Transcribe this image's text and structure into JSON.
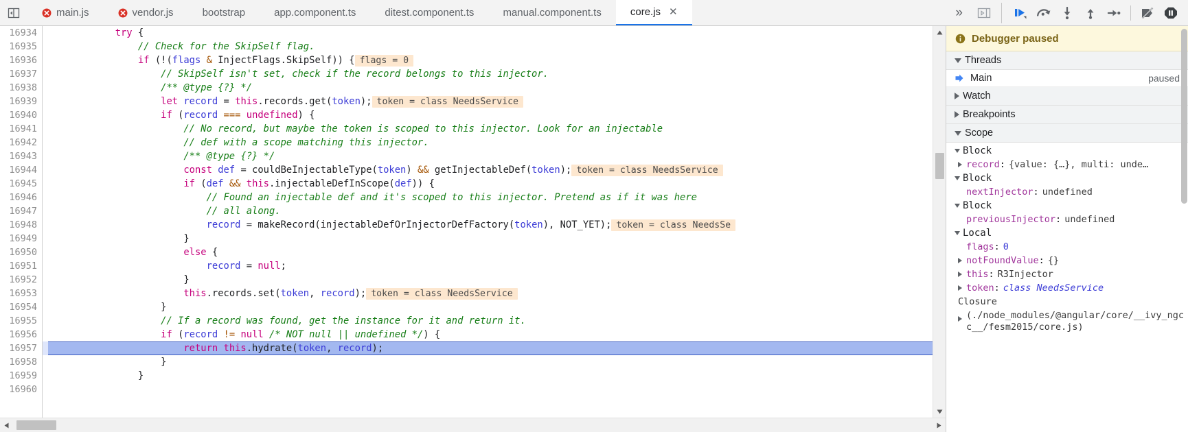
{
  "window": {
    "panel_toggle_icon": "dock-to-left-icon"
  },
  "tabbar": {
    "tabs": [
      {
        "label": "main.js",
        "error": true,
        "active": false
      },
      {
        "label": "vendor.js",
        "error": true,
        "active": false
      },
      {
        "label": "bootstrap",
        "error": false,
        "active": false
      },
      {
        "label": "app.component.ts",
        "error": false,
        "active": false
      },
      {
        "label": "ditest.component.ts",
        "error": false,
        "active": false
      },
      {
        "label": "manual.component.ts",
        "error": false,
        "active": false
      },
      {
        "label": "core.js",
        "error": false,
        "active": true,
        "close": "✕"
      }
    ],
    "more_label": "»"
  },
  "debug_toolbar": {
    "buttons": [
      {
        "name": "show-navigator-button",
        "icon": "panel-layout-icon",
        "tooltip": "Show navigator"
      },
      {
        "name": "resume-button",
        "icon": "resume-script-execution-icon",
        "tooltip": "Resume script execution"
      },
      {
        "name": "step-over-button",
        "icon": "step-over-next-function-call-icon",
        "tooltip": "Step over next function call"
      },
      {
        "name": "step-into-button",
        "icon": "step-into-next-function-call-icon",
        "tooltip": "Step into next function call"
      },
      {
        "name": "step-out-button",
        "icon": "step-out-of-current-function-icon",
        "tooltip": "Step out of current function"
      },
      {
        "name": "step-button",
        "icon": "step-icon",
        "tooltip": "Step"
      },
      {
        "name": "deactivate-breakpoints-button",
        "icon": "deactivate-breakpoints-icon",
        "tooltip": "Deactivate breakpoints"
      },
      {
        "name": "pause-on-exceptions-button",
        "icon": "pause-on-exceptions-icon",
        "tooltip": "Pause on exceptions"
      }
    ]
  },
  "editor": {
    "first_line": 16934,
    "lines": [
      {
        "n": 16934,
        "exec": false,
        "tokens": [
          {
            "t": "            ",
            "c": "pln"
          },
          {
            "t": "try",
            "c": "kw"
          },
          {
            "t": " {",
            "c": "pln"
          }
        ]
      },
      {
        "n": 16935,
        "exec": false,
        "tokens": [
          {
            "t": "                ",
            "c": "pln"
          },
          {
            "t": "// Check for the SkipSelf flag.",
            "c": "cmt"
          }
        ]
      },
      {
        "n": 16936,
        "exec": false,
        "tokens": [
          {
            "t": "                ",
            "c": "pln"
          },
          {
            "t": "if",
            "c": "kw"
          },
          {
            "t": " (!(",
            "c": "pln"
          },
          {
            "t": "flags",
            "c": "var"
          },
          {
            "t": " & ",
            "c": "op"
          },
          {
            "t": "InjectFlags.SkipSelf)) {",
            "c": "pln"
          },
          {
            "t": "flags = 0",
            "c": "chip"
          }
        ]
      },
      {
        "n": 16937,
        "exec": false,
        "tokens": [
          {
            "t": "                    ",
            "c": "pln"
          },
          {
            "t": "// SkipSelf isn't set, check if the record belongs to this injector.",
            "c": "cmt"
          }
        ]
      },
      {
        "n": 16938,
        "exec": false,
        "tokens": [
          {
            "t": "                    ",
            "c": "pln"
          },
          {
            "t": "/** @type {?} */",
            "c": "cmt"
          }
        ]
      },
      {
        "n": 16939,
        "exec": false,
        "tokens": [
          {
            "t": "                    ",
            "c": "pln"
          },
          {
            "t": "let",
            "c": "kw"
          },
          {
            "t": " ",
            "c": "pln"
          },
          {
            "t": "record",
            "c": "var"
          },
          {
            "t": " = ",
            "c": "pln"
          },
          {
            "t": "this",
            "c": "kw"
          },
          {
            "t": ".records.get(",
            "c": "pln"
          },
          {
            "t": "token",
            "c": "var"
          },
          {
            "t": ");",
            "c": "pln"
          },
          {
            "t": "token = class NeedsService",
            "c": "chip"
          }
        ]
      },
      {
        "n": 16940,
        "exec": false,
        "tokens": [
          {
            "t": "                    ",
            "c": "pln"
          },
          {
            "t": "if",
            "c": "kw"
          },
          {
            "t": " (",
            "c": "pln"
          },
          {
            "t": "record",
            "c": "var"
          },
          {
            "t": " === ",
            "c": "op"
          },
          {
            "t": "undefined",
            "c": "kw"
          },
          {
            "t": ") {",
            "c": "pln"
          }
        ]
      },
      {
        "n": 16941,
        "exec": false,
        "tokens": [
          {
            "t": "                        ",
            "c": "pln"
          },
          {
            "t": "// No record, but maybe the token is scoped to this injector. Look for an injectable",
            "c": "cmt"
          }
        ]
      },
      {
        "n": 16942,
        "exec": false,
        "tokens": [
          {
            "t": "                        ",
            "c": "pln"
          },
          {
            "t": "// def with a scope matching this injector.",
            "c": "cmt"
          }
        ]
      },
      {
        "n": 16943,
        "exec": false,
        "tokens": [
          {
            "t": "                        ",
            "c": "pln"
          },
          {
            "t": "/** @type {?} */",
            "c": "cmt"
          }
        ]
      },
      {
        "n": 16944,
        "exec": false,
        "tokens": [
          {
            "t": "                        ",
            "c": "pln"
          },
          {
            "t": "const",
            "c": "kw"
          },
          {
            "t": " ",
            "c": "pln"
          },
          {
            "t": "def",
            "c": "var"
          },
          {
            "t": " = couldBeInjectableType(",
            "c": "pln"
          },
          {
            "t": "token",
            "c": "var"
          },
          {
            "t": ") ",
            "c": "pln"
          },
          {
            "t": "&&",
            "c": "op"
          },
          {
            "t": " getInjectableDef(",
            "c": "pln"
          },
          {
            "t": "token",
            "c": "var"
          },
          {
            "t": ");",
            "c": "pln"
          },
          {
            "t": "token = class NeedsService",
            "c": "chip"
          }
        ]
      },
      {
        "n": 16945,
        "exec": false,
        "tokens": [
          {
            "t": "                        ",
            "c": "pln"
          },
          {
            "t": "if",
            "c": "kw"
          },
          {
            "t": " (",
            "c": "pln"
          },
          {
            "t": "def",
            "c": "var"
          },
          {
            "t": " && ",
            "c": "op"
          },
          {
            "t": "this",
            "c": "kw"
          },
          {
            "t": ".injectableDefInScope(",
            "c": "pln"
          },
          {
            "t": "def",
            "c": "var"
          },
          {
            "t": ")) {",
            "c": "pln"
          }
        ]
      },
      {
        "n": 16946,
        "exec": false,
        "tokens": [
          {
            "t": "                            ",
            "c": "pln"
          },
          {
            "t": "// Found an injectable def and it's scoped to this injector. Pretend as if it was here",
            "c": "cmt"
          }
        ]
      },
      {
        "n": 16947,
        "exec": false,
        "tokens": [
          {
            "t": "                            ",
            "c": "pln"
          },
          {
            "t": "// all along.",
            "c": "cmt"
          }
        ]
      },
      {
        "n": 16948,
        "exec": false,
        "tokens": [
          {
            "t": "                            ",
            "c": "pln"
          },
          {
            "t": "record",
            "c": "var"
          },
          {
            "t": " = makeRecord(injectableDefOrInjectorDefFactory(",
            "c": "pln"
          },
          {
            "t": "token",
            "c": "var"
          },
          {
            "t": "), NOT_YET);",
            "c": "pln"
          },
          {
            "t": "token = class NeedsSe",
            "c": "chip"
          }
        ]
      },
      {
        "n": 16949,
        "exec": false,
        "tokens": [
          {
            "t": "                        }",
            "c": "pln"
          }
        ]
      },
      {
        "n": 16950,
        "exec": false,
        "tokens": [
          {
            "t": "                        ",
            "c": "pln"
          },
          {
            "t": "else",
            "c": "kw"
          },
          {
            "t": " {",
            "c": "pln"
          }
        ]
      },
      {
        "n": 16951,
        "exec": false,
        "tokens": [
          {
            "t": "                            ",
            "c": "pln"
          },
          {
            "t": "record",
            "c": "var"
          },
          {
            "t": " = ",
            "c": "pln"
          },
          {
            "t": "null",
            "c": "kw"
          },
          {
            "t": ";",
            "c": "pln"
          }
        ]
      },
      {
        "n": 16952,
        "exec": false,
        "tokens": [
          {
            "t": "                        }",
            "c": "pln"
          }
        ]
      },
      {
        "n": 16953,
        "exec": false,
        "tokens": [
          {
            "t": "                        ",
            "c": "pln"
          },
          {
            "t": "this",
            "c": "kw"
          },
          {
            "t": ".records.set(",
            "c": "pln"
          },
          {
            "t": "token",
            "c": "var"
          },
          {
            "t": ", ",
            "c": "pln"
          },
          {
            "t": "record",
            "c": "var"
          },
          {
            "t": ");",
            "c": "pln"
          },
          {
            "t": "token = class NeedsService",
            "c": "chip"
          }
        ]
      },
      {
        "n": 16954,
        "exec": false,
        "tokens": [
          {
            "t": "                    }",
            "c": "pln"
          }
        ]
      },
      {
        "n": 16955,
        "exec": false,
        "tokens": [
          {
            "t": "                    ",
            "c": "pln"
          },
          {
            "t": "// If a record was found, get the instance for it and return it.",
            "c": "cmt"
          }
        ]
      },
      {
        "n": 16956,
        "exec": false,
        "tokens": [
          {
            "t": "                    ",
            "c": "pln"
          },
          {
            "t": "if",
            "c": "kw"
          },
          {
            "t": " (",
            "c": "pln"
          },
          {
            "t": "record",
            "c": "var"
          },
          {
            "t": " != ",
            "c": "op"
          },
          {
            "t": "null",
            "c": "kw"
          },
          {
            "t": " ",
            "c": "pln"
          },
          {
            "t": "/* NOT null || undefined */",
            "c": "cmt"
          },
          {
            "t": ") {",
            "c": "pln"
          }
        ]
      },
      {
        "n": 16957,
        "exec": true,
        "tokens": [
          {
            "t": "                        ",
            "c": "pln"
          },
          {
            "t": "return",
            "c": "kw"
          },
          {
            "t": " ",
            "c": "pln"
          },
          {
            "t": "this",
            "c": "kw"
          },
          {
            "t": ".hydrate(",
            "c": "pln"
          },
          {
            "t": "token",
            "c": "var"
          },
          {
            "t": ", ",
            "c": "pln"
          },
          {
            "t": "record",
            "c": "var"
          },
          {
            "t": ");",
            "c": "pln"
          }
        ]
      },
      {
        "n": 16958,
        "exec": false,
        "tokens": [
          {
            "t": "                    }",
            "c": "pln"
          }
        ]
      },
      {
        "n": 16959,
        "exec": false,
        "tokens": [
          {
            "t": "                }",
            "c": "pln"
          }
        ]
      },
      {
        "n": 16960,
        "exec": false,
        "tokens": [
          {
            "t": "",
            "c": "pln"
          }
        ]
      }
    ]
  },
  "sidebar": {
    "paused_banner": {
      "label": "Debugger paused",
      "icon": "info-icon",
      "bg": "#fdf8dd",
      "fg": "#7a6417"
    },
    "threads": {
      "label": "Threads",
      "expanded": true,
      "rows": [
        {
          "name": "Main",
          "state": "paused",
          "icon": "current-thread-arrow-icon"
        }
      ]
    },
    "watch": {
      "label": "Watch",
      "expanded": false
    },
    "breakpoints": {
      "label": "Breakpoints",
      "expanded": false
    },
    "scope": {
      "label": "Scope",
      "expanded": true,
      "groups": [
        {
          "label": "Block",
          "expanded": true,
          "vars": [
            {
              "name": "record",
              "value": "{value: {…}, multi: unde…",
              "kind": "txt",
              "expandable": true
            }
          ]
        },
        {
          "label": "Block",
          "expanded": true,
          "vars": [
            {
              "name": "nextInjector",
              "value": "undefined",
              "kind": "txt",
              "expandable": false
            }
          ]
        },
        {
          "label": "Block",
          "expanded": true,
          "vars": [
            {
              "name": "previousInjector",
              "value": "undefined",
              "kind": "txt",
              "expandable": false
            }
          ]
        },
        {
          "label": "Local",
          "expanded": true,
          "vars": [
            {
              "name": "flags",
              "value": "0",
              "kind": "num",
              "expandable": false
            },
            {
              "name": "notFoundValue",
              "value": "{}",
              "kind": "txt",
              "expandable": true
            },
            {
              "name": "this",
              "value": "R3Injector",
              "kind": "txt",
              "expandable": true
            },
            {
              "name": "token",
              "value": "class NeedsService",
              "kind": "cls",
              "expandable": true
            }
          ]
        }
      ],
      "closure": {
        "label": "Closure",
        "path": "(./node_modules/@angular/core/__ivy_ngcc__/fesm2015/core.js)",
        "expandable": true
      }
    }
  },
  "colors": {
    "accent": "#1a73e8",
    "exec_line": "#a3b8f0",
    "chip_bg": "#fde7cf",
    "error_red": "#d93025",
    "keyword": "#c5007c",
    "comment": "#177e17",
    "variable": "#3b3bd6",
    "operator": "#a35200",
    "scope_name": "#a0349b"
  }
}
